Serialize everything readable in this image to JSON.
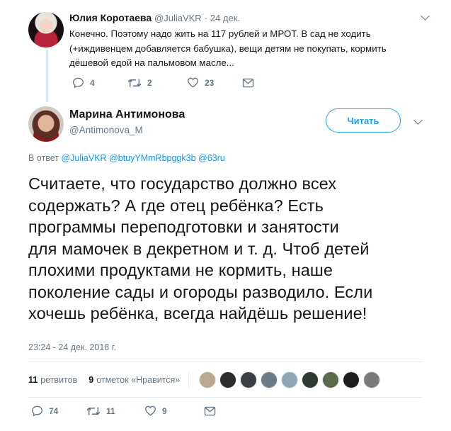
{
  "reply_tweet": {
    "author_name": "Юлия Коротаева",
    "author_handle": "@JuliaVKR",
    "date": "24 дек.",
    "meta_separator": "·",
    "text": "Конечно. Поэтому надо жить на 117 рублей и МРОТ. В сад не ходить (+иждивенцем добавляется бабушка), вещи детям не покупать, кормить дёшевой едой на пальмовом масле...",
    "counts": {
      "replies": "4",
      "retweets": "2",
      "likes": "23"
    }
  },
  "main_tweet": {
    "author_name": "Марина Антимонова",
    "author_handle": "@Antimonova_M",
    "follow_label": "Читать",
    "reply_to_prefix": "В ответ",
    "reply_to_handles": [
      "@JuliaVKR",
      "@btuyYMmRbpggk3b",
      "@63ru"
    ],
    "text": "Считаете, что государство должно всех\nсодержать?  А где отец ребёнка? Есть\nпрограммы переподготовки и занятости\nдля мамочек в декретном и т. д. Чтоб детей\nплохими продуктами не кормить, наше\nпоколение сады и огороды разводило. Если\nхочешь ребёнка, всегда найдёшь решение!",
    "timestamp": "23:24 - 24 дек. 2018 г.",
    "stats": {
      "retweets_count": "11",
      "retweets_label": "ретвитов",
      "likes_count": "9",
      "likes_label": "отметок «Нравится»"
    },
    "counts": {
      "replies": "74",
      "retweets": "11",
      "likes": "9"
    }
  },
  "colors": {
    "accent": "#1da1f2",
    "link": "#1b95e0",
    "muted": "#657786",
    "thread_line": "#c4ebf7"
  },
  "likers": [
    {
      "icon": "liker-avatar-1",
      "color": "#b9a98e"
    },
    {
      "icon": "liker-avatar-2",
      "color": "#2c2c2c"
    },
    {
      "icon": "liker-avatar-3",
      "color": "#3b3f44"
    },
    {
      "icon": "liker-avatar-4",
      "color": "#6e7a84"
    },
    {
      "icon": "liker-avatar-5",
      "color": "#8fa6b6"
    },
    {
      "icon": "liker-avatar-6",
      "color": "#2f3a33"
    },
    {
      "icon": "liker-avatar-7",
      "color": "#5a6b4a"
    },
    {
      "icon": "liker-avatar-8",
      "color": "#1e1e1e"
    },
    {
      "icon": "liker-avatar-9",
      "color": "#7b7b7b"
    }
  ]
}
